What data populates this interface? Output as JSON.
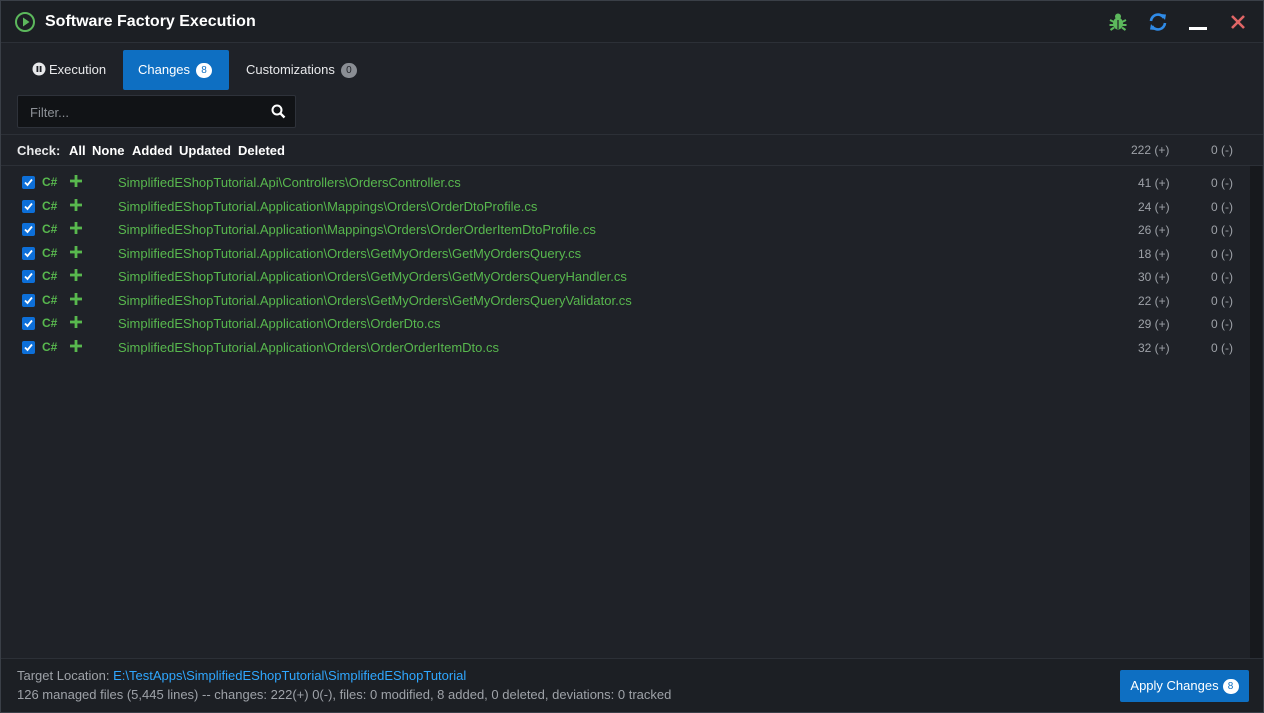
{
  "window": {
    "title": "Software Factory Execution"
  },
  "titlebar_buttons": [
    {
      "name": "debug-icon",
      "color": "#5cb85c"
    },
    {
      "name": "refresh-icon",
      "color": "#2f8be8"
    },
    {
      "name": "minimize-icon",
      "color": "#ffffff"
    },
    {
      "name": "close-icon",
      "color": "#e06666"
    }
  ],
  "tabs": [
    {
      "label": "Execution",
      "icon": "pause-icon",
      "active": false
    },
    {
      "label": "Changes",
      "badge": "8",
      "active": true
    },
    {
      "label": "Customizations",
      "badge": "0",
      "active": false
    }
  ],
  "filter": {
    "placeholder": "Filter..."
  },
  "check_bar": {
    "label": "Check:",
    "options": [
      "All",
      "None",
      "Added",
      "Updated",
      "Deleted"
    ],
    "total_added": "222 (+)",
    "total_deleted": "0 (-)"
  },
  "files": [
    {
      "checked": true,
      "lang": "C#",
      "status": "added",
      "path": "SimplifiedEShopTutorial.Api\\Controllers\\OrdersController.cs",
      "added": "41 (+)",
      "deleted": "0 (-)"
    },
    {
      "checked": true,
      "lang": "C#",
      "status": "added",
      "path": "SimplifiedEShopTutorial.Application\\Mappings\\Orders\\OrderDtoProfile.cs",
      "added": "24 (+)",
      "deleted": "0 (-)"
    },
    {
      "checked": true,
      "lang": "C#",
      "status": "added",
      "path": "SimplifiedEShopTutorial.Application\\Mappings\\Orders\\OrderOrderItemDtoProfile.cs",
      "added": "26 (+)",
      "deleted": "0 (-)"
    },
    {
      "checked": true,
      "lang": "C#",
      "status": "added",
      "path": "SimplifiedEShopTutorial.Application\\Orders\\GetMyOrders\\GetMyOrdersQuery.cs",
      "added": "18 (+)",
      "deleted": "0 (-)"
    },
    {
      "checked": true,
      "lang": "C#",
      "status": "added",
      "path": "SimplifiedEShopTutorial.Application\\Orders\\GetMyOrders\\GetMyOrdersQueryHandler.cs",
      "added": "30 (+)",
      "deleted": "0 (-)"
    },
    {
      "checked": true,
      "lang": "C#",
      "status": "added",
      "path": "SimplifiedEShopTutorial.Application\\Orders\\GetMyOrders\\GetMyOrdersQueryValidator.cs",
      "added": "22 (+)",
      "deleted": "0 (-)"
    },
    {
      "checked": true,
      "lang": "C#",
      "status": "added",
      "path": "SimplifiedEShopTutorial.Application\\Orders\\OrderDto.cs",
      "added": "29 (+)",
      "deleted": "0 (-)"
    },
    {
      "checked": true,
      "lang": "C#",
      "status": "added",
      "path": "SimplifiedEShopTutorial.Application\\Orders\\OrderOrderItemDto.cs",
      "added": "32 (+)",
      "deleted": "0 (-)"
    }
  ],
  "footer": {
    "target_label": "Target Location:",
    "target_path": "E:\\TestApps\\SimplifiedEShopTutorial\\SimplifiedEShopTutorial",
    "stats": "126 managed files (5,445 lines) -- changes: 222(+) 0(-), files: 0 modified, 8 added, 0 deleted, deviations: 0 tracked",
    "apply_label": "Apply Changes",
    "apply_badge": "8"
  },
  "colors": {
    "accent": "#0e6fc2",
    "added_green": "#58b84e",
    "link_blue": "#2fa7ff"
  }
}
